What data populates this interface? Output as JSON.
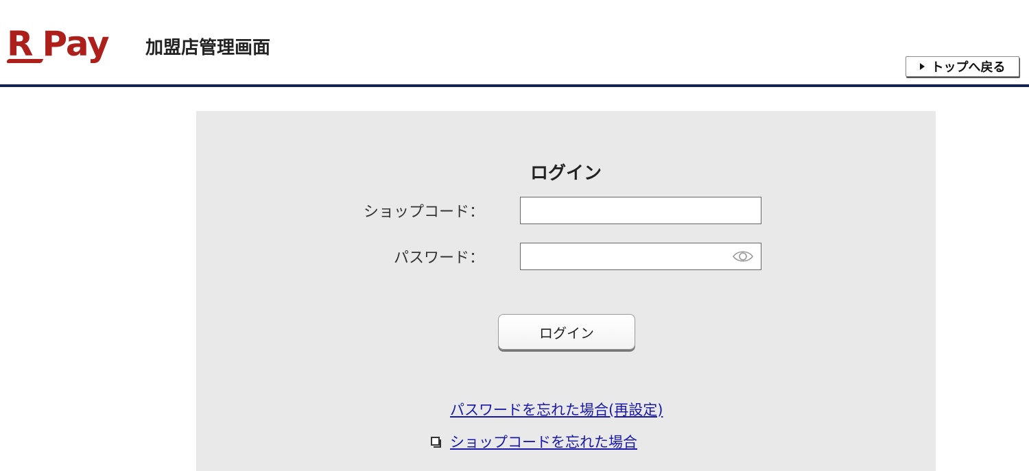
{
  "header": {
    "logo_r": "R",
    "logo_pay": "Pay",
    "title": "加盟店管理画面",
    "back_button_label": "トップへ戻る"
  },
  "login": {
    "title": "ログイン",
    "shop_code_label": "ショップコード：",
    "shop_code_value": "",
    "password_label": "パスワード：",
    "password_value": "",
    "submit_label": "ログイン",
    "forgot_password_link": "パスワードを忘れた場合(再設定)",
    "forgot_shop_code_link": "ショップコードを忘れた場合"
  },
  "icons": {
    "show_password": "eye-icon",
    "new_window": "new-window-icon"
  },
  "colors": {
    "brand": "#ad1f1b",
    "header_rule": "#16205a",
    "panel_background": "#e9e9e9",
    "link": "#1a1aa6"
  }
}
